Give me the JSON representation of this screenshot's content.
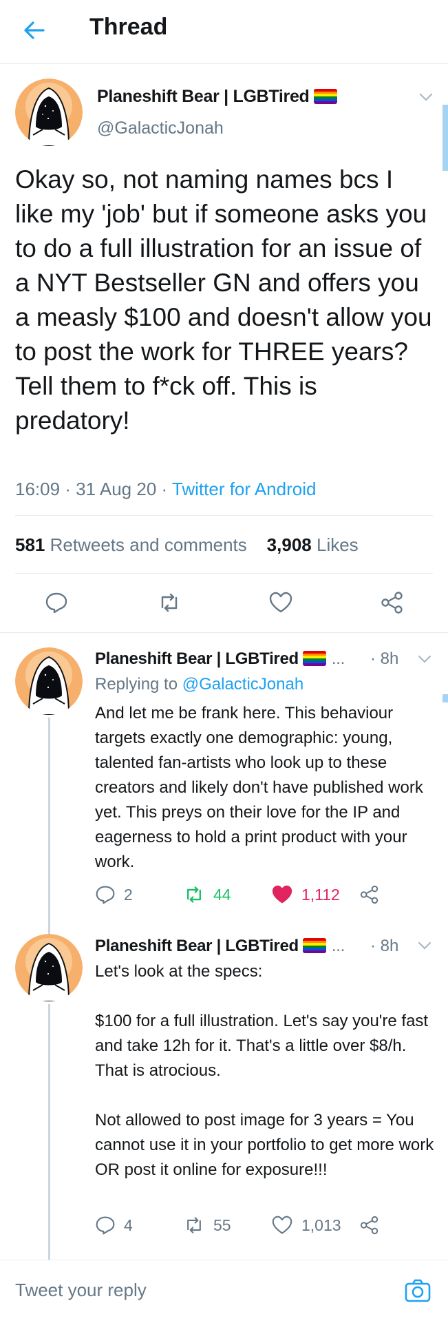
{
  "header": {
    "title": "Thread"
  },
  "main_tweet": {
    "name": "Planeshift Bear | LGBTired",
    "handle": "@GalacticJonah",
    "text": "Okay so, not naming names bcs I like my 'job' but if someone asks you to do a full illustration for an issue of a NYT Bestseller GN and offers you a measly $100 and doesn't allow you to post the work for THREE years?\nTell them to f*ck off. This is predatory!",
    "time": "16:09 · 31 Aug 20 · ",
    "source": "Twitter for Android",
    "retweets_count": "581",
    "retweets_label": "Retweets and comments",
    "likes_count": "3,908",
    "likes_label": "Likes"
  },
  "replies": [
    {
      "name": "Planeshift Bear | LGBTired",
      "ellipsis": "...",
      "time": "· 8h",
      "replying_prefix": "Replying to ",
      "replying_to": "@GalacticJonah",
      "text": "And let me be frank here. This behaviour targets exactly one demographic: young, talented fan-artists who look up to these creators and likely don't have published work yet. This preys on their love for the IP and eagerness to hold a print product with your work.",
      "reply_count": "2",
      "retweet_count": "44",
      "like_count": "1,112",
      "liked": true,
      "retweeted": true
    },
    {
      "name": "Planeshift Bear | LGBTired",
      "ellipsis": "...",
      "time": "· 8h",
      "text": "Let's look at the specs:\n\n$100 for a full illustration. Let's say you're fast and take 12h for it. That's a little over $8/h. That is atrocious.\n\nNot allowed to post image for 3 years = You cannot use it in your portfolio to get more work OR post it online for exposure!!!",
      "reply_count": "4",
      "retweet_count": "55",
      "like_count": "1,013",
      "liked": false,
      "retweeted": false
    }
  ],
  "compose": {
    "placeholder": "Tweet your reply"
  },
  "colors": {
    "accent": "#1da1f2",
    "retweet_green": "#17bf63",
    "like_red": "#e0245e",
    "secondary_text": "#657786",
    "avatar_bg": "#f6b06b"
  }
}
